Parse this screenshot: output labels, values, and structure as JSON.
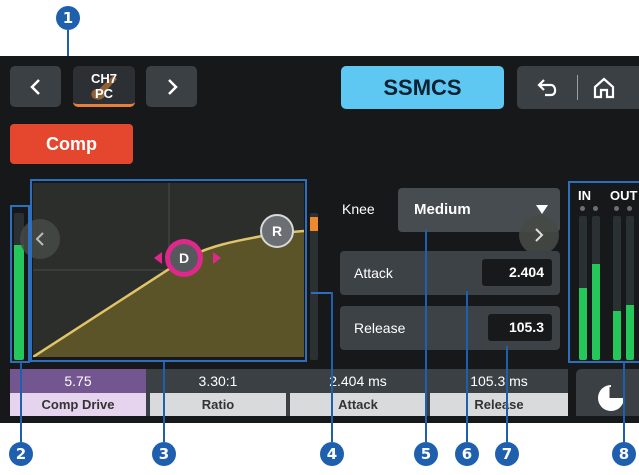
{
  "header": {
    "prev_label": "‹",
    "next_label": "›",
    "channel_line1": "CH7",
    "channel_line2": "PC",
    "title": "SSMCS"
  },
  "comp_button": "Comp",
  "graph": {
    "dynamics_handle": "D",
    "release_handle": "R"
  },
  "knee": {
    "label": "Knee",
    "value": "Medium"
  },
  "attack": {
    "label": "Attack",
    "value": "2.404"
  },
  "release": {
    "label": "Release",
    "value": "105.3"
  },
  "meters": {
    "in_label": "IN",
    "out_label": "OUT",
    "input_level": 0.78,
    "gr_level": 0.92,
    "in_levels": [
      0.5,
      0.67
    ],
    "out_levels": [
      0.34,
      0.38
    ]
  },
  "params": [
    {
      "value": "5.75",
      "label": "Comp Drive"
    },
    {
      "value": "3.30:1",
      "label": "Ratio"
    },
    {
      "value": "2.404 ms",
      "label": "Attack"
    },
    {
      "value": "105.3 ms",
      "label": "Release"
    }
  ],
  "callouts": [
    "1",
    "2",
    "3",
    "4",
    "5",
    "6",
    "7",
    "8"
  ],
  "colors": {
    "accent": "#5ec8f3",
    "comp": "#e5472e",
    "handle": "#e0288c",
    "meter": "#25c65a",
    "callout": "#1e5fae"
  }
}
